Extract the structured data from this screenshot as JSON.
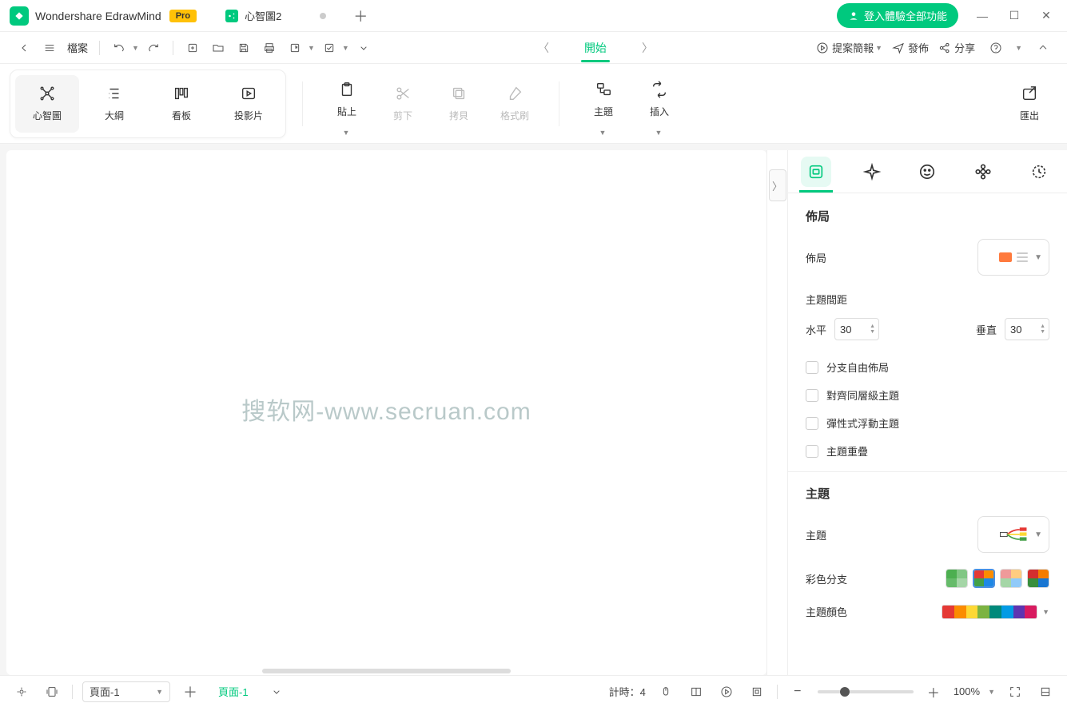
{
  "app": {
    "title": "Wondershare EdrawMind",
    "badge": "Pro"
  },
  "tab": {
    "name": "心智圖2"
  },
  "titlebar": {
    "login": "登入體驗全部功能"
  },
  "quickbar": {
    "file": "檔案"
  },
  "tabnav": {
    "start": "開始"
  },
  "rightActions": {
    "present": "提案簡報",
    "publish": "發佈",
    "share": "分享"
  },
  "views": {
    "mindmap": "心智圖",
    "outline": "大綱",
    "kanban": "看板",
    "slide": "投影片"
  },
  "ribbon": {
    "paste": "貼上",
    "cut": "剪下",
    "copy": "拷貝",
    "format": "格式刷",
    "topic": "主題",
    "insert": "插入",
    "export": "匯出"
  },
  "canvas": {
    "watermark": "搜软网-www.secruan.com"
  },
  "panel": {
    "layout_section": "佈局",
    "layout": "佈局",
    "spacing_title": "主題間距",
    "horizontal": "水平",
    "horizontal_val": "30",
    "vertical": "垂直",
    "vertical_val": "30",
    "check_free": "分支自由佈局",
    "check_align": "對齊同層級主題",
    "check_float": "彈性式浮動主題",
    "check_overlap": "主題重疊",
    "theme_section": "主題",
    "theme": "主題",
    "branch_color": "彩色分支",
    "theme_color": "主題顏色"
  },
  "status": {
    "page_sel": "頁面-1",
    "page_tab": "頁面-1",
    "timer": "計時：4",
    "zoom": "100%"
  },
  "colors": {
    "accent": "#00c97e",
    "rainbow": [
      "#e53935",
      "#fb8c00",
      "#fdd835",
      "#7cb342",
      "#00897b",
      "#039be5",
      "#5e35b1",
      "#d81b60"
    ]
  }
}
